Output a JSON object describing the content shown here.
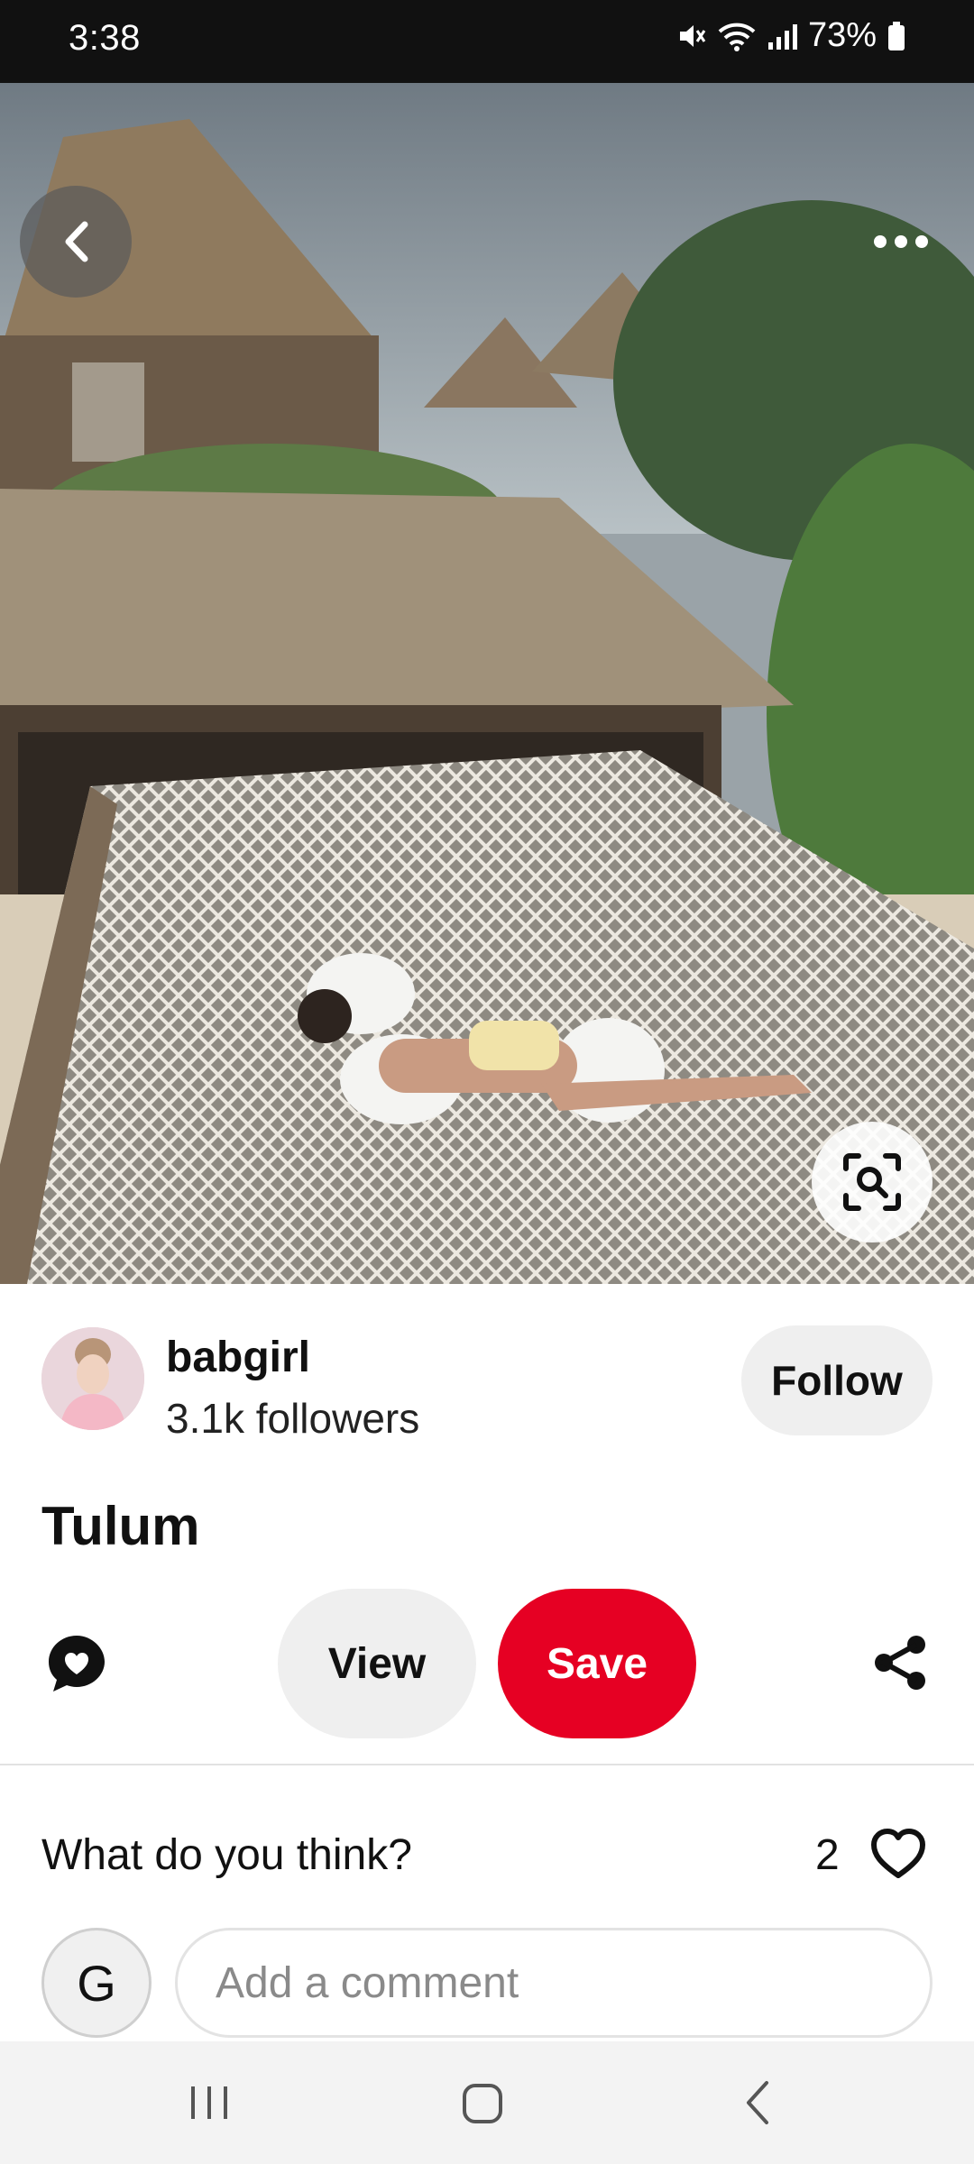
{
  "status_bar": {
    "time": "3:38",
    "battery": "73%",
    "icons": [
      "mute-icon",
      "wifi-icon",
      "signal-icon",
      "battery-icon"
    ]
  },
  "pin": {
    "title": "Tulum",
    "image_alt": "hammock-net-beach-photo"
  },
  "author": {
    "name": "babgirl",
    "followers": "3.1k followers",
    "follow_label": "Follow"
  },
  "actions": {
    "view_label": "View",
    "save_label": "Save"
  },
  "comments": {
    "prompt": "What do you think?",
    "reaction_count": "2",
    "user_initial": "G",
    "input_placeholder": "Add a comment"
  },
  "colors": {
    "save": "#e60023",
    "button_gray": "#efefef",
    "status_bar": "#111111"
  }
}
